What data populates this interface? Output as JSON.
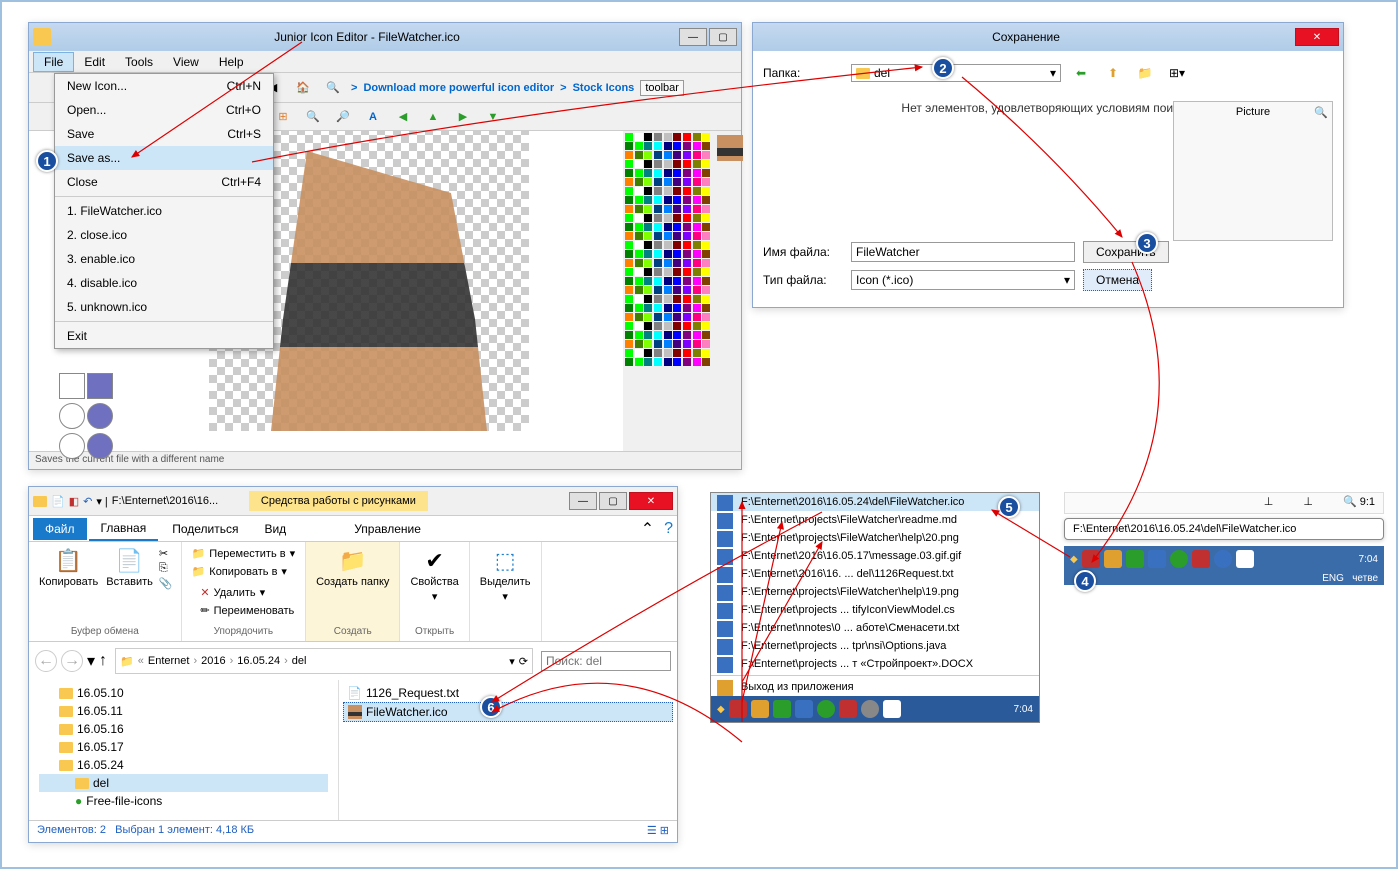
{
  "iconEditor": {
    "title": "Junior Icon Editor - FileWatcher.ico",
    "menus": [
      "File",
      "Edit",
      "Tools",
      "View",
      "Help"
    ],
    "fileMenu": {
      "newIcon": {
        "label": "New Icon...",
        "shortcut": "Ctrl+N"
      },
      "open": {
        "label": "Open...",
        "shortcut": "Ctrl+O"
      },
      "save": {
        "label": "Save",
        "shortcut": "Ctrl+S"
      },
      "saveAs": {
        "label": "Save as...",
        "shortcut": ""
      },
      "close": {
        "label": "Close",
        "shortcut": "Ctrl+F4"
      },
      "recent": [
        "1. FileWatcher.ico",
        "2. close.ico",
        "3. enable.ico",
        "4. disable.ico",
        "5. unknown.ico"
      ],
      "exit": "Exit"
    },
    "toolbarLinks": {
      "download": "Download more powerful icon editor",
      "stock": "Stock Icons",
      "toolbarTag": "toolbar"
    },
    "statusText": "Saves the current file with a different name"
  },
  "saveDialog": {
    "title": "Сохранение",
    "folderLabel": "Папка:",
    "folderValue": "del",
    "emptyText": "Нет элементов, удовлетворяющих условиям поиска.",
    "pictureLabel": "Picture",
    "fileNameLabel": "Имя файла:",
    "fileNameValue": "FileWatcher",
    "fileTypeLabel": "Тип файла:",
    "fileTypeValue": "Icon (*.ico)",
    "saveBtn": "Сохранить",
    "cancelBtn": "Отмена"
  },
  "explorer": {
    "qatPath": "F:\\Enternet\\2016\\16...",
    "contextTab": "Средства работы с рисунками",
    "tabs": {
      "file": "Файл",
      "home": "Главная",
      "share": "Поделиться",
      "view": "Вид",
      "manage": "Управление"
    },
    "ribbon": {
      "copy": "Копировать",
      "paste": "Вставить",
      "moveTo": "Переместить в",
      "copyTo": "Копировать в",
      "delete": "Удалить",
      "rename": "Переименовать",
      "newFolder": "Создать папку",
      "properties": "Свойства",
      "select": "Выделить",
      "groups": {
        "clipboard": "Буфер обмена",
        "organize": "Упорядочить",
        "create": "Создать",
        "open": "Открыть",
        "select": ""
      }
    },
    "breadcrumb": [
      "Enternet",
      "2016",
      "16.05.24",
      "del"
    ],
    "searchPlaceholder": "Поиск: del",
    "tree": [
      "16.05.10",
      "16.05.11",
      "16.05.16",
      "16.05.17",
      "16.05.24"
    ],
    "treeSelected": "del",
    "treeExtra": "Free-file-icons",
    "files": {
      "f1": "1126_Request.txt",
      "f2": "FileWatcher.ico"
    },
    "status": {
      "count": "Элементов: 2",
      "selection": "Выбран 1 элемент: 4,18 КБ"
    }
  },
  "jumplist": {
    "items": [
      "F:\\Enternet\\2016\\16.05.24\\del\\FileWatcher.ico",
      "F:\\Enternet\\projects\\FileWatcher\\readme.md",
      "F:\\Enternet\\projects\\FileWatcher\\help\\20.png",
      "F:\\Enternet\\2016\\16.05.17\\message.03.gif.gif",
      "F:\\Enternet\\2016\\16. ... del\\1126Request.txt",
      "F:\\Enternet\\projects\\FileWatcher\\help\\19.png",
      "F:\\Enternet\\projects ... tifyIconViewModel.cs",
      "F:\\Enternet\\nnotes\\0 ... аботе\\Сменасети.txt",
      "F:\\Enternet\\projects ... tpr\\nsi\\Options.java",
      "F:\\Enternet\\projects ... т «Стройпроект».DOCX"
    ],
    "exit": "Выход из приложения",
    "time": "7:04"
  },
  "tooltip": {
    "text": "F:\\Enternet\\2016\\16.05.24\\del\\FileWatcher.ico",
    "zoom": "9:1",
    "time": "7:04",
    "lang": "ENG",
    "day": "четве"
  },
  "badges": {
    "b1": "1",
    "b2": "2",
    "b3": "3",
    "b4": "4",
    "b5": "5",
    "b6": "6"
  }
}
